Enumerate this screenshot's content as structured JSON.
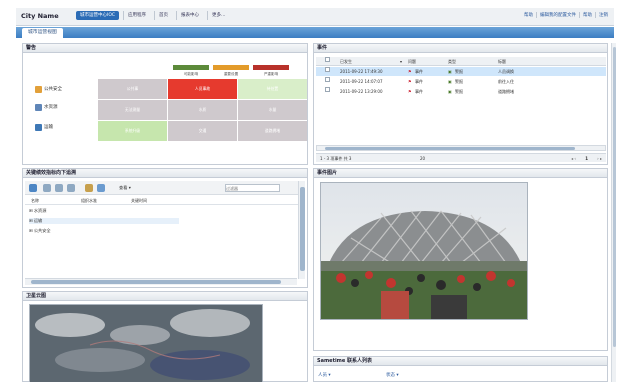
{
  "header": {
    "city": "City Name",
    "nav": [
      "城市运营中心IOC",
      "应用程序",
      "首页",
      "报表中心",
      "更多..."
    ],
    "links": [
      "帮助",
      "编辑我的配置文件",
      "帮助",
      "注销"
    ]
  },
  "page_tab": "城市运营视图",
  "alarm_panel": {
    "title": "警告",
    "legend": [
      {
        "label": "可能影响",
        "color": "#5c8a3a"
      },
      {
        "label": "重要设置",
        "color": "#e39b2a"
      },
      {
        "label": "严重影响",
        "color": "#b8312a"
      }
    ],
    "rows": [
      {
        "label": "公共安全",
        "cells": [
          "公共事",
          "人员事故",
          "待处置"
        ]
      },
      {
        "label": "水资源",
        "cells": [
          "无法测量",
          "水质",
          "水量"
        ]
      },
      {
        "label": "运输",
        "cells": [
          "系统升级",
          "交通",
          "道路拥堵"
        ]
      }
    ]
  },
  "event_panel": {
    "title": "事件",
    "columns": [
      "已发生",
      "问题",
      "类型",
      "标题"
    ],
    "rows": [
      {
        "date": "2011-09-22 17:49:30",
        "issue": "事件",
        "type": "警报",
        "title": "人员调换"
      },
      {
        "date": "2011-09-22 14:07:07",
        "issue": "事件",
        "type": "警报",
        "title": "前往入住"
      },
      {
        "date": "2011-09-22 13:29:00",
        "issue": "事件",
        "type": "警报",
        "title": "道路拥堵"
      }
    ],
    "pager_left": "1 - 3 项事件 共 3",
    "pager_mid": "20",
    "pager_page": "1"
  },
  "kpi_panel": {
    "title": "关键绩效指标向下追溯",
    "search_placeholder": "过滤器",
    "view_label": "查看",
    "columns": [
      "名称",
      "组织水准",
      "关键时间"
    ],
    "rows": [
      "水资源",
      "运输",
      "公共安全"
    ]
  },
  "photo_panel": {
    "title": "事件图片"
  },
  "satellite_panel": {
    "title": "卫星云图"
  },
  "sametime_panel": {
    "title": "Sametime 联系人列表",
    "left_label": "人员",
    "right_label": "状态"
  },
  "colors": {
    "accent": "#2b6cb6",
    "alarm_red": "#e63a2e",
    "alarm_green": "#c6e6ad",
    "alarm_grey": "#cfc9cd"
  }
}
